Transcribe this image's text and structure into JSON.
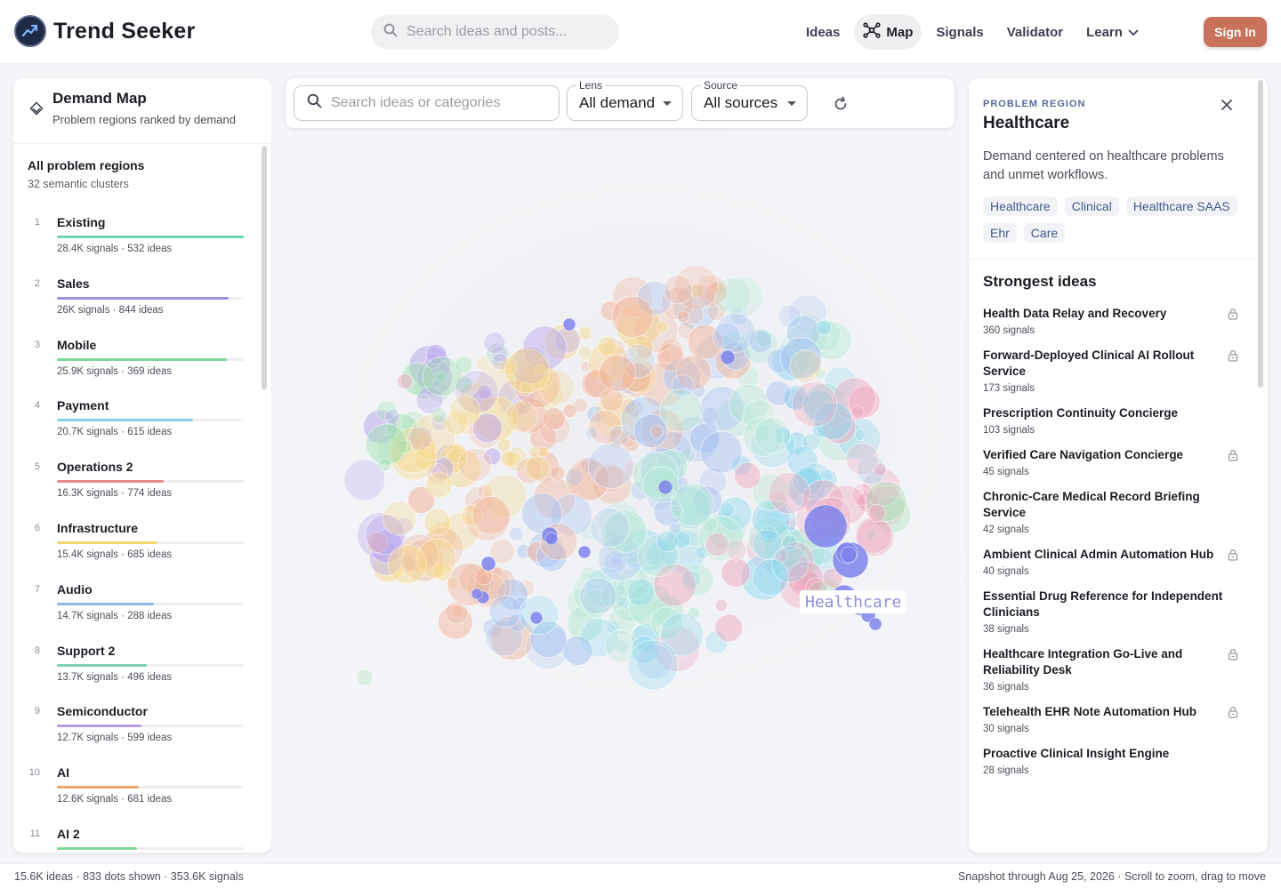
{
  "app": {
    "name": "Trend Seeker",
    "logo_icon": "trend-chart-icon"
  },
  "search": {
    "placeholder": "Search ideas and posts..."
  },
  "nav": {
    "items": [
      {
        "label": "Ideas",
        "active": false
      },
      {
        "label": "Map",
        "active": true,
        "icon": "network-icon"
      },
      {
        "label": "Signals",
        "active": false
      },
      {
        "label": "Validator",
        "active": false
      },
      {
        "label": "Learn",
        "active": false,
        "icon": "chevron-down-icon"
      }
    ],
    "signin_label": "Sign In"
  },
  "left_panel": {
    "title": "Demand Map",
    "subtitle": "Problem regions ranked by demand",
    "group_title": "All problem regions",
    "group_sub": "32 semantic clusters",
    "regions": [
      {
        "rank": "1",
        "name": "Existing",
        "meta": "28.4K signals · 532 ideas",
        "share": 1.0,
        "color": "#6fd3b7"
      },
      {
        "rank": "2",
        "name": "Sales",
        "meta": "26K signals · 844 ideas",
        "share": 0.92,
        "color": "#9b8fe0"
      },
      {
        "rank": "3",
        "name": "Mobile",
        "meta": "25.9K signals · 369 ideas",
        "share": 0.91,
        "color": "#7dd69a"
      },
      {
        "rank": "4",
        "name": "Payment",
        "meta": "20.7K signals · 615 ideas",
        "share": 0.73,
        "color": "#7fd0e6"
      },
      {
        "rank": "5",
        "name": "Operations 2",
        "meta": "16.3K signals · 774 ideas",
        "share": 0.57,
        "color": "#e6888f"
      },
      {
        "rank": "6",
        "name": "Infrastructure",
        "meta": "15.4K signals · 685 ideas",
        "share": 0.54,
        "color": "#f0d670"
      },
      {
        "rank": "7",
        "name": "Audio",
        "meta": "14.7K signals · 288 ideas",
        "share": 0.52,
        "color": "#8db6e8"
      },
      {
        "rank": "8",
        "name": "Support 2",
        "meta": "13.7K signals · 496 ideas",
        "share": 0.48,
        "color": "#7fd0b0"
      },
      {
        "rank": "9",
        "name": "Semiconductor",
        "meta": "12.7K signals · 599 ideas",
        "share": 0.45,
        "color": "#b49be6"
      },
      {
        "rank": "10",
        "name": "AI",
        "meta": "12.6K signals · 681 ideas",
        "share": 0.44,
        "color": "#efa56a"
      },
      {
        "rank": "11",
        "name": "AI 2",
        "meta": "",
        "share": 0.43,
        "color": "#7fd79a"
      }
    ]
  },
  "map": {
    "search_placeholder": "Search ideas or categories",
    "lens": {
      "label": "Lens",
      "value": "All demand"
    },
    "source": {
      "label": "Source",
      "value": "All sources"
    },
    "highlight_label": "Healthcare",
    "highlight_color": "#7e84ec"
  },
  "right_panel": {
    "kicker": "PROBLEM REGION",
    "title": "Healthcare",
    "description": "Demand centered on healthcare problems and unmet workflows.",
    "tags": [
      "Healthcare",
      "Clinical",
      "Healthcare SAAS",
      "Ehr",
      "Care"
    ],
    "section_title": "Strongest ideas",
    "ideas": [
      {
        "title": "Health Data Relay and Recovery",
        "signals": "360 signals",
        "locked": true
      },
      {
        "title": "Forward-Deployed Clinical AI Rollout Service",
        "signals": "173 signals",
        "locked": true
      },
      {
        "title": "Prescription Continuity Concierge",
        "signals": "103 signals",
        "locked": false
      },
      {
        "title": "Verified Care Navigation Concierge",
        "signals": "45 signals",
        "locked": true
      },
      {
        "title": "Chronic-Care Medical Record Briefing Service",
        "signals": "42 signals",
        "locked": false
      },
      {
        "title": "Ambient Clinical Admin Automation Hub",
        "signals": "40 signals",
        "locked": true
      },
      {
        "title": "Essential Drug Reference for Independent Clinicians",
        "signals": "38 signals",
        "locked": false
      },
      {
        "title": "Healthcare Integration Go-Live and Reliability Desk",
        "signals": "36 signals",
        "locked": true
      },
      {
        "title": "Telehealth EHR Note Automation Hub",
        "signals": "30 signals",
        "locked": true
      },
      {
        "title": "Proactive Clinical Insight Engine",
        "signals": "28 signals",
        "locked": false
      }
    ]
  },
  "status": {
    "left": "15.6K ideas · 833 dots shown · 353.6K signals",
    "right": "Snapshot through Aug 25, 2026 · Scroll to zoom, drag to move"
  }
}
